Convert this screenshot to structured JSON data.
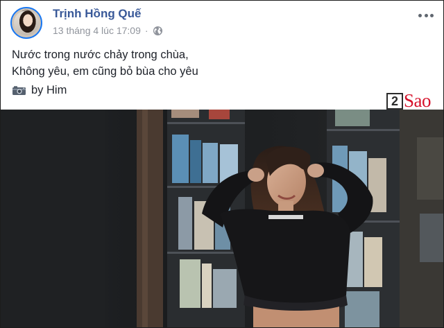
{
  "post": {
    "author": "Trịnh Hồng Quế",
    "timestamp": "13 tháng 4 lúc 17:09",
    "separator": "·",
    "privacy_icon": "globe-icon",
    "more_icon": "more-horizontal-icon",
    "lines": [
      "Nước trong nước chảy trong chùa,",
      "Không yêu, em cũng bỏ bùa cho yêu"
    ],
    "credit_icon": "camera-icon",
    "credit": "by Him"
  },
  "watermark": {
    "box": "2",
    "text": "Sao"
  },
  "colors": {
    "author": "#385898",
    "meta": "#90949c",
    "text": "#1d2129",
    "watermark_red": "#d6122b",
    "avatar_ring": "#1877f2"
  }
}
